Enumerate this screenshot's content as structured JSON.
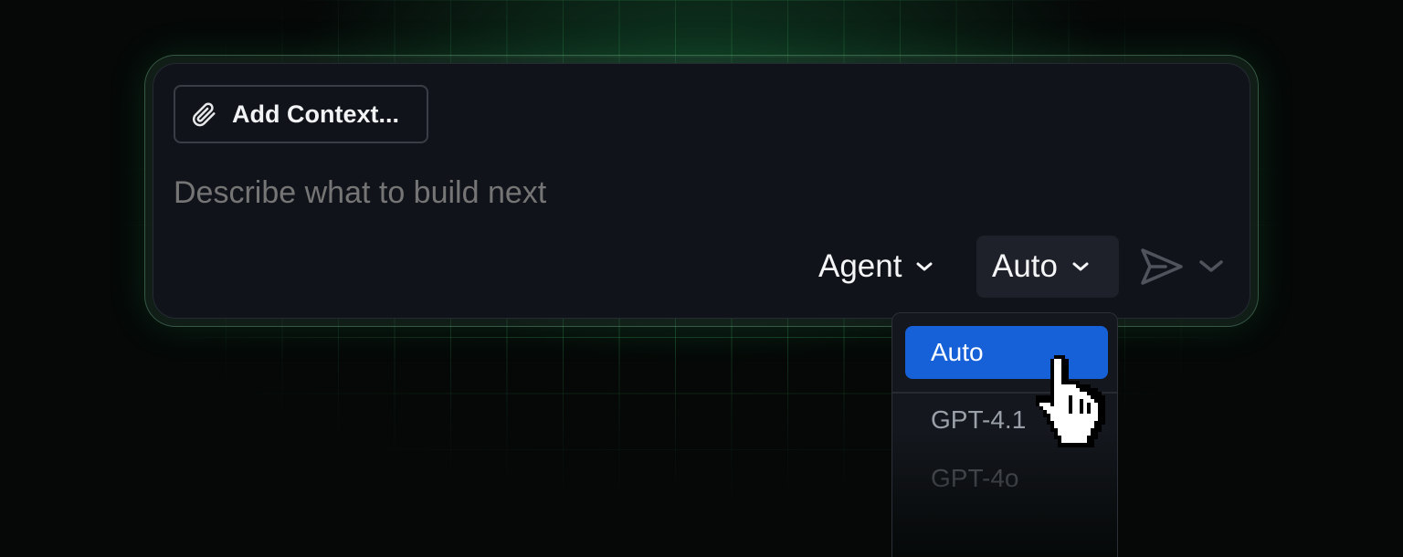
{
  "composer": {
    "add_context_label": "Add Context...",
    "prompt_placeholder": "Describe what to build next",
    "mode_label": "Agent",
    "model_label": "Auto"
  },
  "model_menu": {
    "options": [
      {
        "label": "Auto",
        "selected": true
      },
      {
        "label": "GPT-4.1",
        "selected": false
      },
      {
        "label": "GPT-4o",
        "selected": false
      }
    ]
  },
  "icons": {
    "attach": "paperclip-icon",
    "send": "send-icon",
    "chevron": "chevron-down-icon",
    "cursor": "hand-pointer-cursor"
  },
  "colors": {
    "background": "#050807",
    "grid": "#4ac86e",
    "panel": "#11131a",
    "accent": "#1660d8"
  }
}
